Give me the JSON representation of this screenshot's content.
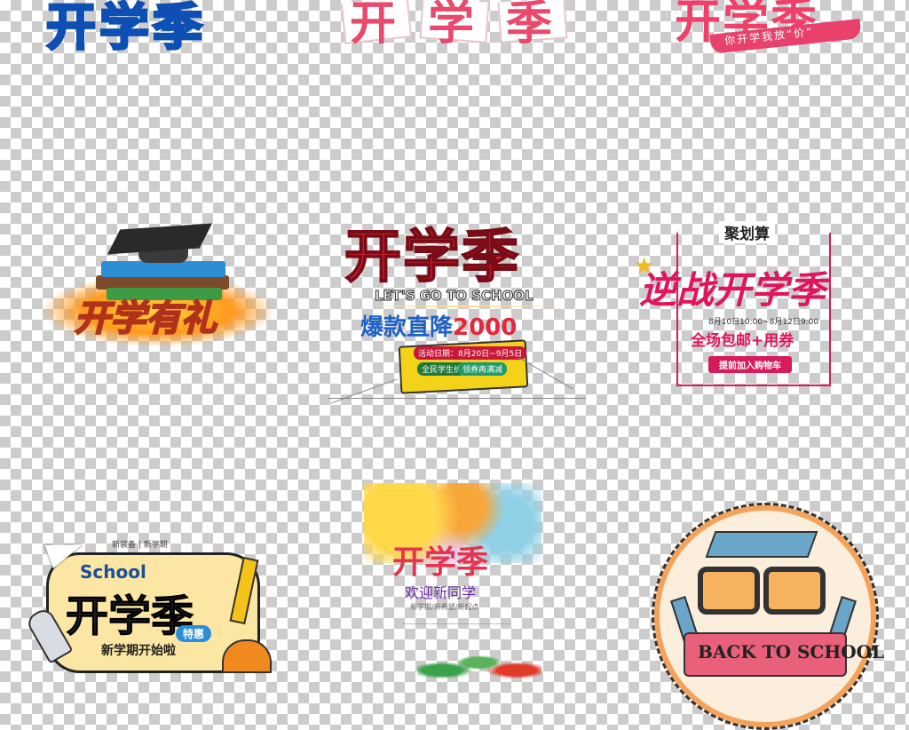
{
  "tiles": {
    "t1": {
      "title": "开学季"
    },
    "t2": {
      "chars": [
        "开",
        "学",
        "季"
      ]
    },
    "t3": {
      "title": "开学季",
      "ribbon": "你开学我放“价”"
    },
    "t4": {
      "title": "开学有礼"
    },
    "t5": {
      "title": "开学季",
      "english": "LET'S GO TO SCHOOL",
      "hot": "爆款直降",
      "amount": "2000",
      "event_date": "活动日期：8月20日~9月5日",
      "tag1": "全民学生价",
      "tag2": "领券再满减"
    },
    "t6": {
      "top": "聚划算",
      "title": "逆战开学季",
      "date": "8月10日10:00~8月12日9:00",
      "sub": "全场包邮+用券",
      "cta": "提前加入购物车"
    },
    "t7": {
      "tag": "新装备 | 新学期",
      "school": "School",
      "title": "开学季",
      "special": "特惠",
      "bottom": "新学期开始啦"
    },
    "t8": {
      "title": "开学季",
      "welcome": "欢迎新同学",
      "small": "新学期/新希望/新起点"
    },
    "t9": {
      "banner": "BACK TO SCHOOL"
    }
  },
  "colors": {
    "checker_dark": "#cccccc",
    "checker_light": "#ffffff",
    "blue": "#1f8bf5",
    "pink": "#e8496c",
    "red": "#e5263c",
    "magenta": "#e0155d"
  }
}
